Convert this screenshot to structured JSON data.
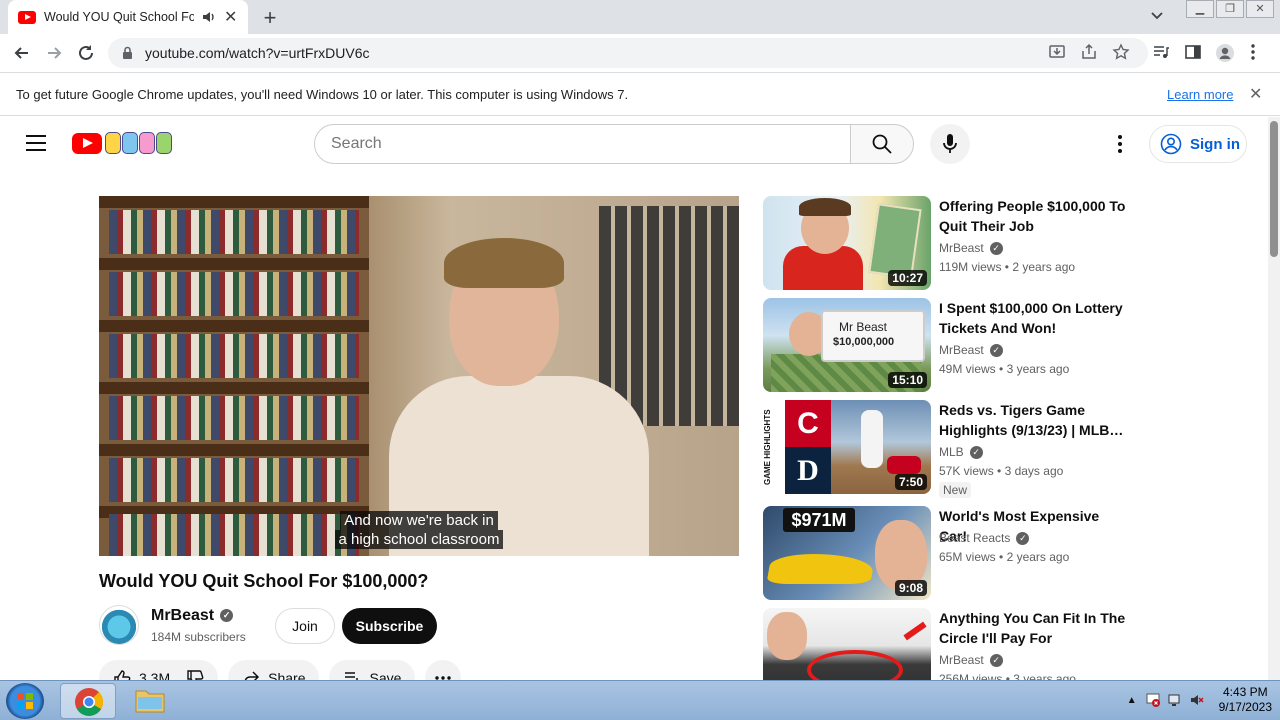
{
  "browser": {
    "tab_title": "Would YOU Quit School For",
    "tab_close": "✕",
    "new_tab": "+",
    "url": "youtube.com/watch?v=urtFrxDUV6c",
    "infobar_message": "To get future Google Chrome updates, you'll need Windows 10 or later. This computer is using Windows 7.",
    "infobar_link": "Learn more",
    "infobar_close": "✕"
  },
  "youtube": {
    "search_placeholder": "Search",
    "sign_in": "Sign in"
  },
  "video": {
    "caption_line1": "And now we're back in",
    "caption_line2": "a high school classroom",
    "title": "Would YOU Quit School For $100,000?",
    "channel": "MrBeast",
    "subscribers": "184M subscribers",
    "join": "Join",
    "subscribe": "Subscribe",
    "likes": "3.3M",
    "share": "Share",
    "save": "Save"
  },
  "recommendations": [
    {
      "title": "Offering People $100,000 To Quit Their Job",
      "channel": "MrBeast",
      "views": "119M views",
      "age": "2 years ago",
      "duration": "10:27",
      "badge": ""
    },
    {
      "title": "I Spent $100,000 On Lottery Tickets And Won!",
      "channel": "MrBeast",
      "views": "49M views",
      "age": "3 years ago",
      "duration": "15:10",
      "badge": ""
    },
    {
      "title": "Reds vs. Tigers Game Highlights (9/13/23) | MLB…",
      "channel": "MLB",
      "views": "57K views",
      "age": "3 days ago",
      "duration": "7:50",
      "badge": "New"
    },
    {
      "title": "World's Most Expensive Car!",
      "channel": "Beast Reacts",
      "views": "65M views",
      "age": "2 years ago",
      "duration": "9:08",
      "badge": ""
    },
    {
      "title": "Anything You Can Fit In The Circle I'll Pay For",
      "channel": "MrBeast",
      "views": "256M views",
      "age": "3 years ago",
      "duration": "",
      "badge": ""
    }
  ],
  "thumb_text": {
    "lottery_sign": "$10,000,000",
    "lottery_name": "Mr Beast",
    "car_price": "$971M",
    "game_highlights": "GAME HIGHLIGHTS"
  },
  "taskbar": {
    "time": "4:43 PM",
    "date": "9/17/2023"
  },
  "colors": {
    "youtube_red": "#ff0000",
    "link_blue": "#065fd4",
    "subscribe_bg": "#0f0f0f"
  },
  "icons": [
    "back-icon",
    "forward-icon",
    "reload-icon",
    "lock-icon",
    "install-icon",
    "share-icon",
    "star-icon",
    "media-icon",
    "sidepanel-icon",
    "profile-icon",
    "menu-icon",
    "search-icon",
    "mic-icon",
    "kebab-icon",
    "account-icon",
    "like-icon",
    "dislike-icon",
    "share-arrow-icon",
    "save-icon",
    "more-icon"
  ]
}
